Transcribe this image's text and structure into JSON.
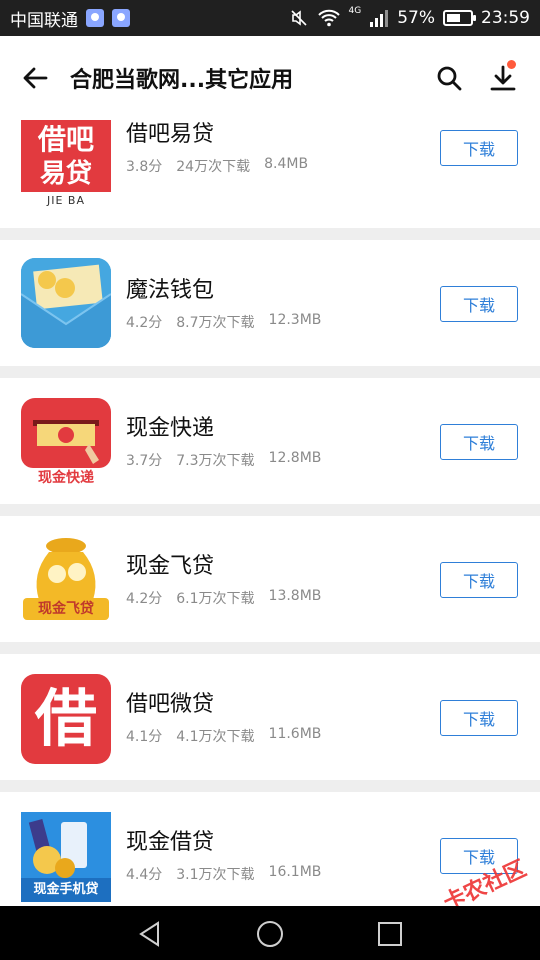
{
  "status_bar": {
    "carrier": "中国联通",
    "network": "4G",
    "battery_percent_text": "57%",
    "battery_level": 0.57,
    "time": "23:59"
  },
  "header": {
    "title": "合肥当歌网...其它应用",
    "icons": [
      "back-arrow-icon",
      "search-icon",
      "download-icon"
    ]
  },
  "apps": [
    {
      "name": "借吧易贷",
      "rating": "3.8分",
      "downloads": "24万次下载",
      "size": "8.4MB",
      "button": "下载",
      "icon_text_top": "借吧",
      "icon_text_bottom": "易贷",
      "icon_caption": "JIE BA"
    },
    {
      "name": "魔法钱包",
      "rating": "4.2分",
      "downloads": "8.7万次下载",
      "size": "12.3MB",
      "button": "下载"
    },
    {
      "name": "现金快递",
      "rating": "3.7分",
      "downloads": "7.3万次下载",
      "size": "12.8MB",
      "button": "下载",
      "icon_caption": "现金快递"
    },
    {
      "name": "现金飞贷",
      "rating": "4.2分",
      "downloads": "6.1万次下载",
      "size": "13.8MB",
      "button": "下载",
      "icon_caption": "现金飞贷"
    },
    {
      "name": "借吧微贷",
      "rating": "4.1分",
      "downloads": "4.1万次下载",
      "size": "11.6MB",
      "button": "下载",
      "icon_text": "借"
    },
    {
      "name": "现金借贷",
      "rating": "4.4分",
      "downloads": "3.1万次下载",
      "size": "16.1MB",
      "button": "下载",
      "icon_caption": "现金手机贷"
    }
  ],
  "watermark": "卡农社区",
  "colors": {
    "accent": "#2f7fd8",
    "status_bar": "#202020",
    "nav_bar": "#000000",
    "notification_dot": "#ff5a3c"
  }
}
